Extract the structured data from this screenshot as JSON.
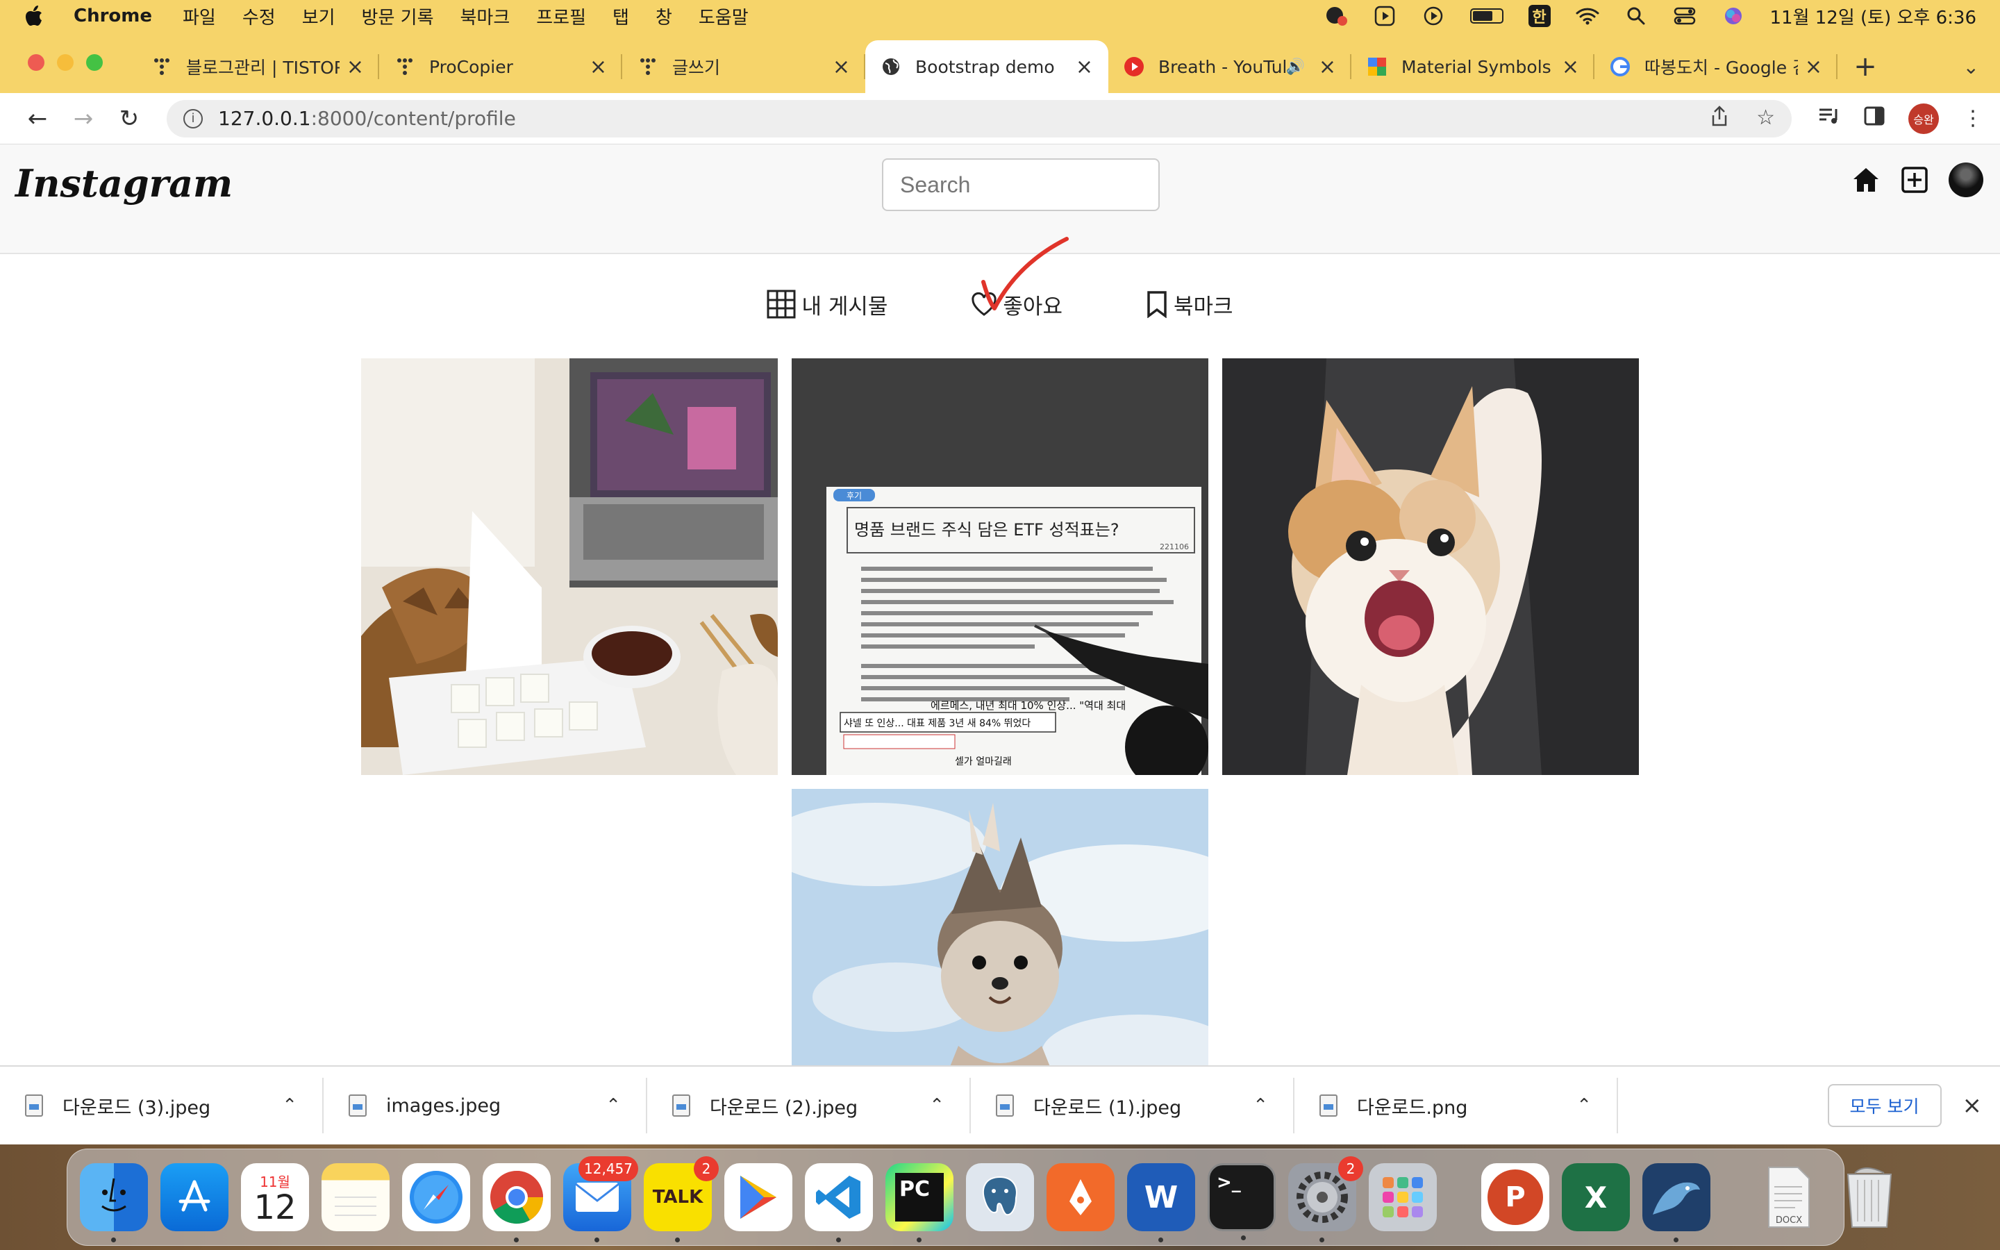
{
  "menubar": {
    "app": "Chrome",
    "items": [
      "파일",
      "수정",
      "보기",
      "방문 기록",
      "북마크",
      "프로필",
      "탭",
      "창",
      "도움말"
    ],
    "input_method": "한",
    "clock": "11월 12일 (토) 오후 6:36"
  },
  "tabs": [
    {
      "title": "블로그관리 | TISTORY",
      "icon": "tistory-icon"
    },
    {
      "title": "ProCopier",
      "icon": "tistory-icon"
    },
    {
      "title": "글쓰기",
      "icon": "tistory-icon"
    },
    {
      "title": "Bootstrap demo",
      "icon": "globe-icon",
      "active": true
    },
    {
      "title": "Breath - YouTub",
      "icon": "youtube-icon",
      "audio": true
    },
    {
      "title": "Material Symbols ar",
      "icon": "material-icon"
    },
    {
      "title": "따봉도치 - Google 검",
      "icon": "google-icon"
    }
  ],
  "address": {
    "host": "127.0.0.1",
    "path": ":8000/content/profile"
  },
  "profile": {
    "initials": "승완"
  },
  "instagram": {
    "logo": "Instagram",
    "search_placeholder": "Search",
    "profile_tabs": [
      {
        "label": "내 게시물",
        "icon": "grid-icon"
      },
      {
        "label": "좋아요",
        "icon": "heart-icon"
      },
      {
        "label": "북마크",
        "icon": "bookmark-icon"
      }
    ],
    "posts": [
      {
        "subject": "fried chicken and radish on desk with laptop",
        "palette": [
          "#d8cfc0",
          "#8a5a2a"
        ]
      },
      {
        "subject": "presentation screen with ETF article",
        "palette": [
          "#f2f2f2",
          "#333333"
        ],
        "screen_text": {
          "badge": "후기",
          "title": "명품 브랜드 주식 담은 ETF 성적표는?",
          "date": "221106",
          "caption_1": "에르메스, 내년 최대 10% 인상... \"역대 최대",
          "caption_2": "샤넬 또 인상... 대표 제품 3년 새 84% 뛰었다",
          "caption_3": "셀가 얼마길래"
        }
      },
      {
        "subject": "kitten with raised paw",
        "palette": [
          "#3a3a3a",
          "#f0e6dc"
        ]
      },
      {
        "subject": "hedgehog held up against sky",
        "palette": [
          "#cfe0ee",
          "#8a7766"
        ]
      }
    ]
  },
  "downloads": {
    "items": [
      "다운로드 (3).jpeg",
      "images.jpeg",
      "다운로드 (2).jpeg",
      "다운로드 (1).jpeg",
      "다운로드.png"
    ],
    "show_all": "모두 보기"
  },
  "dock": {
    "calendar_month": "11월",
    "calendar_day": "12",
    "mail_badge": "12,457",
    "talk_label": "TALK",
    "talk_badge": "2",
    "pycharm_label": "PC",
    "word_label": "W",
    "terminal_label": ">_",
    "settings_badge": "2",
    "ppt_label": "P",
    "excel_label": "X",
    "docx_label": "DOCX"
  }
}
